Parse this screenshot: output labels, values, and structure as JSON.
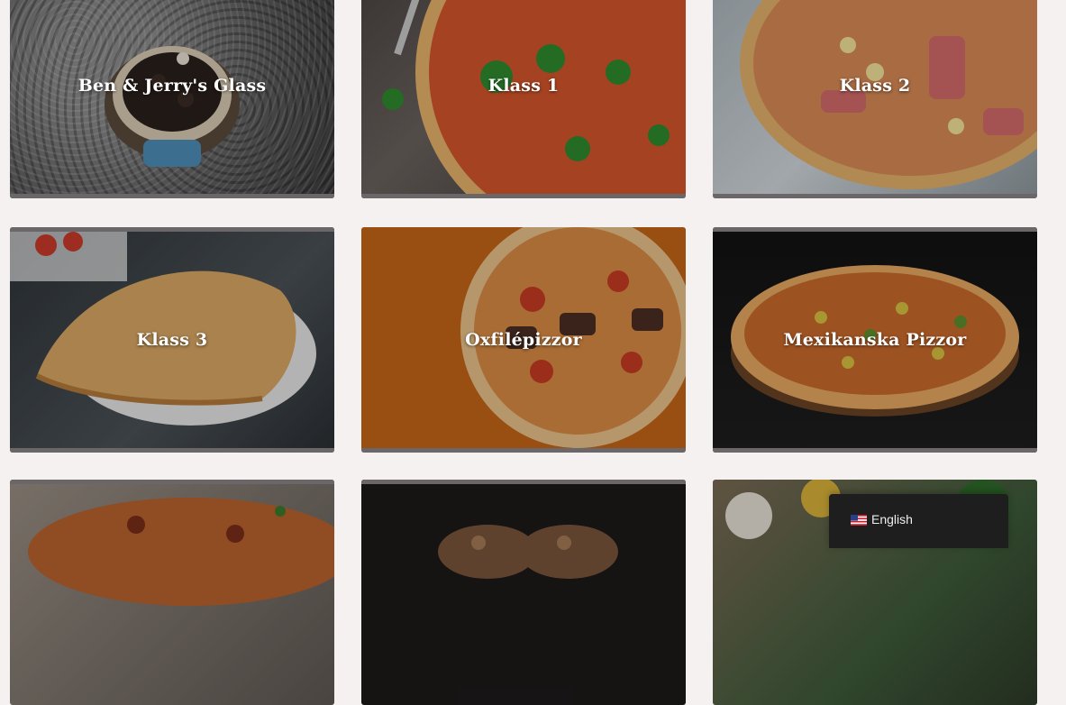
{
  "menu": {
    "items": [
      {
        "title": "Ben & Jerry's Glass"
      },
      {
        "title": "Klass 1"
      },
      {
        "title": "Klass 2"
      },
      {
        "title": "Klass 3"
      },
      {
        "title": "Oxfilépizzor"
      },
      {
        "title": "Mexikanska Pizzor"
      },
      {
        "title": ""
      },
      {
        "title": ""
      },
      {
        "title": ""
      }
    ]
  },
  "language_switcher": {
    "label": "English",
    "flag_icon": "us-flag-icon"
  },
  "colors": {
    "page_background": "#f5f1f1",
    "card_bar": "#6b6667",
    "switcher_background": "#1e1e1e"
  }
}
